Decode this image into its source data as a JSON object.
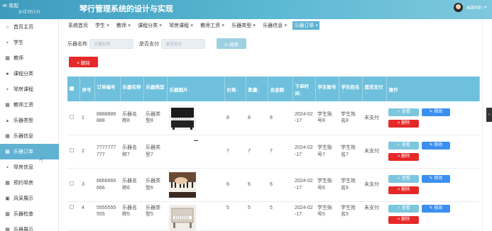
{
  "header": {
    "back": "≪ 收起",
    "logo": "admin",
    "title": "琴行管理系统的设计与实现",
    "user": "admin"
  },
  "sidebar": {
    "items": [
      {
        "label": "首页主页",
        "icon": "home-icon",
        "glyph": "⌂"
      },
      {
        "label": "学生",
        "icon": "user-icon",
        "glyph": "▪"
      },
      {
        "label": "教师",
        "icon": "grid-icon",
        "glyph": "▦"
      },
      {
        "label": "课程分类",
        "icon": "pin-icon",
        "glyph": "●"
      },
      {
        "label": "琴房课程",
        "icon": "book-icon",
        "glyph": "▪"
      },
      {
        "label": "教师工资",
        "icon": "grid-icon",
        "glyph": "▦"
      },
      {
        "label": "乐器类型",
        "icon": "user-icon",
        "glyph": "▴"
      },
      {
        "label": "乐器信息",
        "icon": "grid-icon",
        "glyph": "▦"
      },
      {
        "label": "乐器订单",
        "icon": "grid-icon",
        "glyph": "▦",
        "active": true
      },
      {
        "label": "琴房信息",
        "icon": "book-icon",
        "glyph": "▪"
      },
      {
        "label": "预约琴房",
        "icon": "grid-icon",
        "glyph": "▦"
      },
      {
        "label": "风采展示",
        "icon": "image-icon",
        "glyph": "▣"
      },
      {
        "label": "乐器检查",
        "icon": "grid-icon",
        "glyph": "▦"
      },
      {
        "label": "乐器展示",
        "icon": "grid-icon",
        "glyph": "▦"
      }
    ]
  },
  "tabs": [
    {
      "label": "系统首页"
    },
    {
      "label": "学生 ×"
    },
    {
      "label": "教师 ×"
    },
    {
      "label": "课程分类 ×"
    },
    {
      "label": "琴房课程 ×"
    },
    {
      "label": "教师工资 ×"
    },
    {
      "label": "乐器类型 ×"
    },
    {
      "label": "乐器信息 ×"
    },
    {
      "label": "乐器订单 ×",
      "active": true
    }
  ],
  "search": {
    "name_label": "乐器名称",
    "name_placeholder": "乐器名称",
    "paid_label": "是否支付",
    "paid_placeholder": "是否支付",
    "button": "⊙ 搜索"
  },
  "toolbar": {
    "delete": "× 删除"
  },
  "table": {
    "headers": [
      "",
      "序号",
      "订单编号",
      "乐器名称",
      "乐器类型",
      "乐器图片",
      "价格",
      "数量",
      "总金额",
      "下单时间",
      "学生账号",
      "学生姓名",
      "是否支付",
      "操作"
    ],
    "rows": [
      {
        "idx": "1",
        "order": "8888888888",
        "name": "乐器名称8",
        "type": "乐器类型8",
        "img": "upright-piano",
        "price": "8",
        "qty": "8",
        "total": "8",
        "time": "2024-02-17",
        "account": "学生账号8",
        "student": "学生姓名8",
        "paid": "未支付"
      },
      {
        "idx": "2",
        "order": "7777777777",
        "name": "乐器名称7",
        "type": "乐器类型7",
        "img": "none",
        "price": "7",
        "qty": "7",
        "total": "7",
        "time": "2024-02-17",
        "account": "学生账号7",
        "student": "学生姓名7",
        "paid": "未支付"
      },
      {
        "idx": "3",
        "order": "6666666666",
        "name": "乐器名称6",
        "type": "乐器类型6",
        "img": "piano-keys",
        "price": "6",
        "qty": "6",
        "total": "6",
        "time": "2024-02-17",
        "account": "学生账号6",
        "student": "学生姓名6",
        "paid": "未支付"
      },
      {
        "idx": "4",
        "order": "5555555555",
        "name": "乐器名称5",
        "type": "乐器类型5",
        "img": "piano-box",
        "price": "5",
        "qty": "5",
        "total": "5",
        "time": "2024-02-17",
        "account": "学生账号5",
        "student": "学生姓名5",
        "paid": "未支付"
      }
    ],
    "actions": {
      "view": "✓ 查看",
      "edit": "✎ 修改",
      "delete": "× 删除"
    }
  },
  "colors": {
    "accent": "#5fb2d2",
    "danger": "#e52929",
    "primary": "#3b8ff0"
  }
}
